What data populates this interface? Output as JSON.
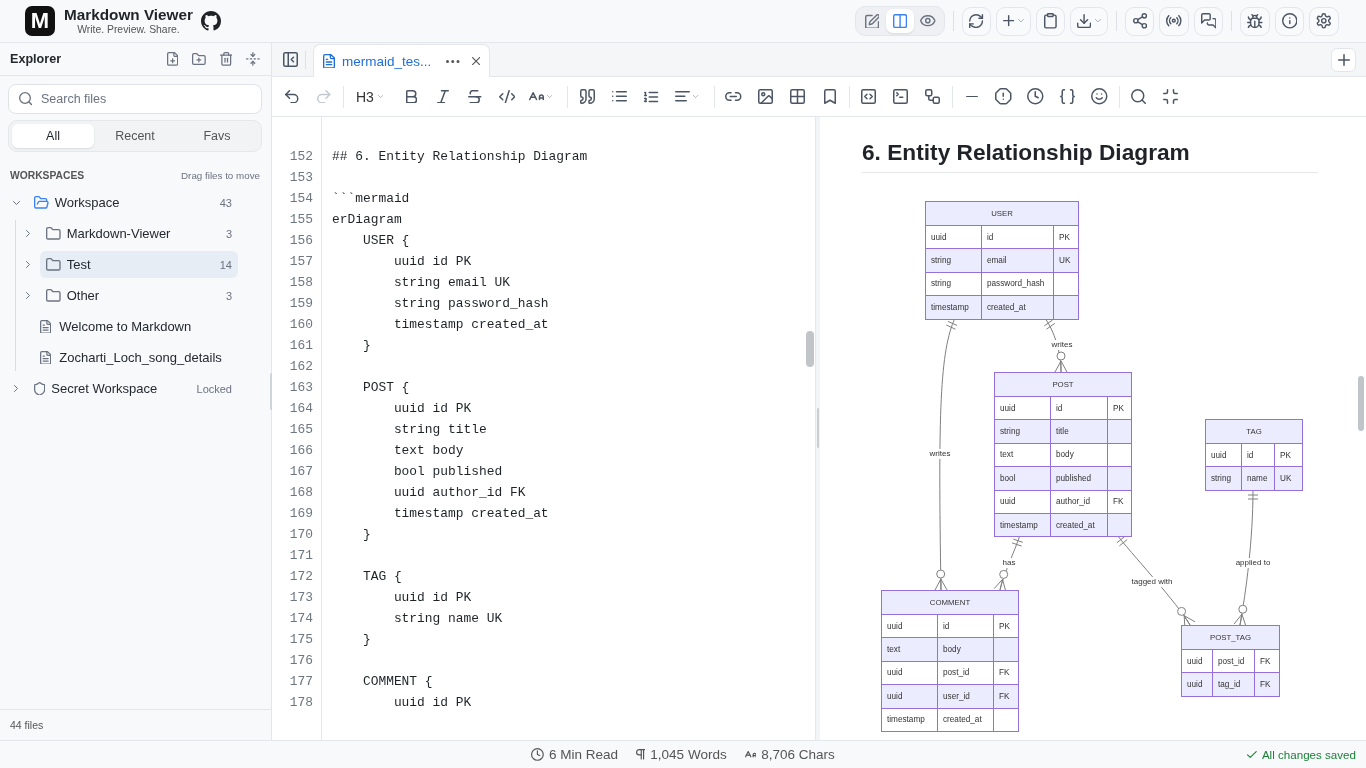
{
  "header": {
    "logo_letter": "M",
    "title": "Markdown Viewer",
    "tagline": "Write. Preview. Share.",
    "view_modes": [
      {
        "kind": "edit",
        "selected": false
      },
      {
        "kind": "split",
        "selected": true
      },
      {
        "kind": "preview",
        "selected": false
      }
    ]
  },
  "sidebar": {
    "title": "Explorer",
    "search": {
      "placeholder": "Search files"
    },
    "filter_tabs": [
      {
        "label": "All",
        "selected": true
      },
      {
        "label": "Recent",
        "selected": false
      },
      {
        "label": "Favs",
        "selected": false
      }
    ],
    "section_title": "WORKSPACES",
    "section_hint": "Drag files to move",
    "tree": [
      {
        "kind": "workspace",
        "label": "Workspace",
        "count": "43",
        "expanded": true,
        "selected": false,
        "children": [
          {
            "kind": "folder",
            "label": "Markdown-Viewer",
            "count": "3",
            "expanded": false,
            "selected": false
          },
          {
            "kind": "folder",
            "label": "Test",
            "count": "14",
            "expanded": false,
            "selected": true
          },
          {
            "kind": "folder",
            "label": "Other",
            "count": "3",
            "expanded": false,
            "selected": false
          },
          {
            "kind": "file",
            "label": "Welcome to Markdown",
            "selected": false
          },
          {
            "kind": "file",
            "label": "Zocharti_Loch_song_details",
            "selected": false
          }
        ]
      },
      {
        "kind": "locked",
        "label": "Secret Workspace",
        "badge": "Locked",
        "expanded": false,
        "selected": false
      }
    ],
    "footer": "44 files"
  },
  "editor_tabs": [
    {
      "label": "mermaid_tes...",
      "selected": true
    }
  ],
  "format_toolbar": {
    "undo": {
      "disabled": false
    },
    "redo": {
      "disabled": true
    },
    "heading_level": "H3"
  },
  "editor": {
    "lines": [
      {
        "number": "152",
        "text": "## 6. Entity Relationship Diagram"
      },
      {
        "number": "153"
      },
      {
        "number": "154",
        "text": "```mermaid"
      },
      {
        "number": "155",
        "text": "erDiagram"
      },
      {
        "number": "156",
        "text": "    USER {"
      },
      {
        "number": "157",
        "text": "        uuid id PK"
      },
      {
        "number": "158",
        "text": "        string email UK"
      },
      {
        "number": "159",
        "text": "        string password_hash"
      },
      {
        "number": "160",
        "text": "        timestamp created_at"
      },
      {
        "number": "161",
        "text": "    }"
      },
      {
        "number": "162"
      },
      {
        "number": "163",
        "text": "    POST {"
      },
      {
        "number": "164",
        "text": "        uuid id PK"
      },
      {
        "number": "165",
        "text": "        string title"
      },
      {
        "number": "166",
        "text": "        text body"
      },
      {
        "number": "167",
        "text": "        bool published"
      },
      {
        "number": "168",
        "text": "        uuid author_id FK"
      },
      {
        "number": "169",
        "text": "        timestamp created_at"
      },
      {
        "number": "170",
        "text": "    }"
      },
      {
        "number": "171"
      },
      {
        "number": "172",
        "text": "    TAG {"
      },
      {
        "number": "173",
        "text": "        uuid id PK"
      },
      {
        "number": "174",
        "text": "        string name UK"
      },
      {
        "number": "175",
        "text": "    }"
      },
      {
        "number": "176"
      },
      {
        "number": "177",
        "text": "    COMMENT {"
      },
      {
        "number": "178",
        "text": "        uuid id PK"
      }
    ]
  },
  "preview": {
    "heading": "6. Entity Relationship Diagram",
    "diagram": {
      "entities": [
        {
          "name": "USER",
          "attributes": [
            {
              "type": "uuid",
              "name": "id",
              "key": "PK"
            },
            {
              "type": "string",
              "name": "email",
              "key": "UK"
            },
            {
              "type": "string",
              "name": "password_hash"
            },
            {
              "type": "timestamp",
              "name": "created_at"
            }
          ]
        },
        {
          "name": "POST",
          "attributes": [
            {
              "type": "uuid",
              "name": "id",
              "key": "PK"
            },
            {
              "type": "string",
              "name": "title"
            },
            {
              "type": "text",
              "name": "body"
            },
            {
              "type": "bool",
              "name": "published"
            },
            {
              "type": "uuid",
              "name": "author_id",
              "key": "FK"
            },
            {
              "type": "timestamp",
              "name": "created_at"
            }
          ]
        },
        {
          "name": "TAG",
          "attributes": [
            {
              "type": "uuid",
              "name": "id",
              "key": "PK"
            },
            {
              "type": "string",
              "name": "name",
              "key": "UK"
            }
          ]
        },
        {
          "name": "COMMENT",
          "attributes": [
            {
              "type": "uuid",
              "name": "id",
              "key": "PK"
            },
            {
              "type": "text",
              "name": "body"
            },
            {
              "type": "uuid",
              "name": "post_id",
              "key": "FK"
            },
            {
              "type": "uuid",
              "name": "user_id",
              "key": "FK"
            },
            {
              "type": "timestamp",
              "name": "created_at"
            }
          ]
        },
        {
          "name": "POST_TAG",
          "attributes": [
            {
              "type": "uuid",
              "name": "post_id",
              "key": "FK"
            },
            {
              "type": "uuid",
              "name": "tag_id",
              "key": "FK"
            }
          ]
        }
      ],
      "relationships": [
        {
          "label": "writes"
        },
        {
          "label": "writes"
        },
        {
          "label": "has"
        },
        {
          "label": "tagged with"
        },
        {
          "label": "applied to"
        }
      ]
    }
  },
  "status_bar": {
    "stats": [
      {
        "kind": "read_time",
        "text": "6 Min Read"
      },
      {
        "kind": "words",
        "text": "1,045 Words"
      },
      {
        "kind": "chars",
        "text": "8,706 Chars"
      }
    ],
    "save_status": "All changes saved"
  }
}
